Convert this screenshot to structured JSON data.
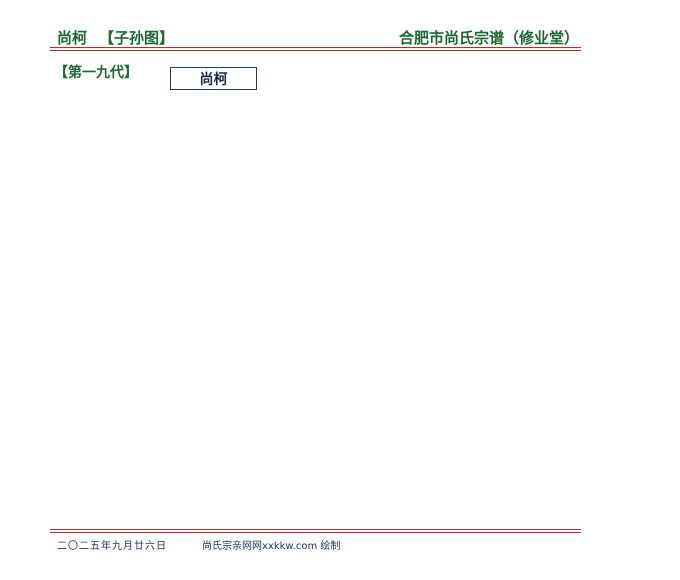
{
  "header": {
    "name": "尚柯",
    "chart_type": "【子孙图】",
    "title": "合肥市尚氏宗谱（修业堂）"
  },
  "generation": {
    "label": "【第一九代】"
  },
  "persons": [
    {
      "name": "尚柯"
    }
  ],
  "footer": {
    "date": "二〇二五年九月廿六日",
    "credit": "尚氏宗亲网网xxkkw.com 绘制"
  },
  "colors": {
    "title_green": "#1a6b2e",
    "rule_red": "#c0272d",
    "box_border": "#1f3864",
    "footer_text": "#1f3864"
  }
}
